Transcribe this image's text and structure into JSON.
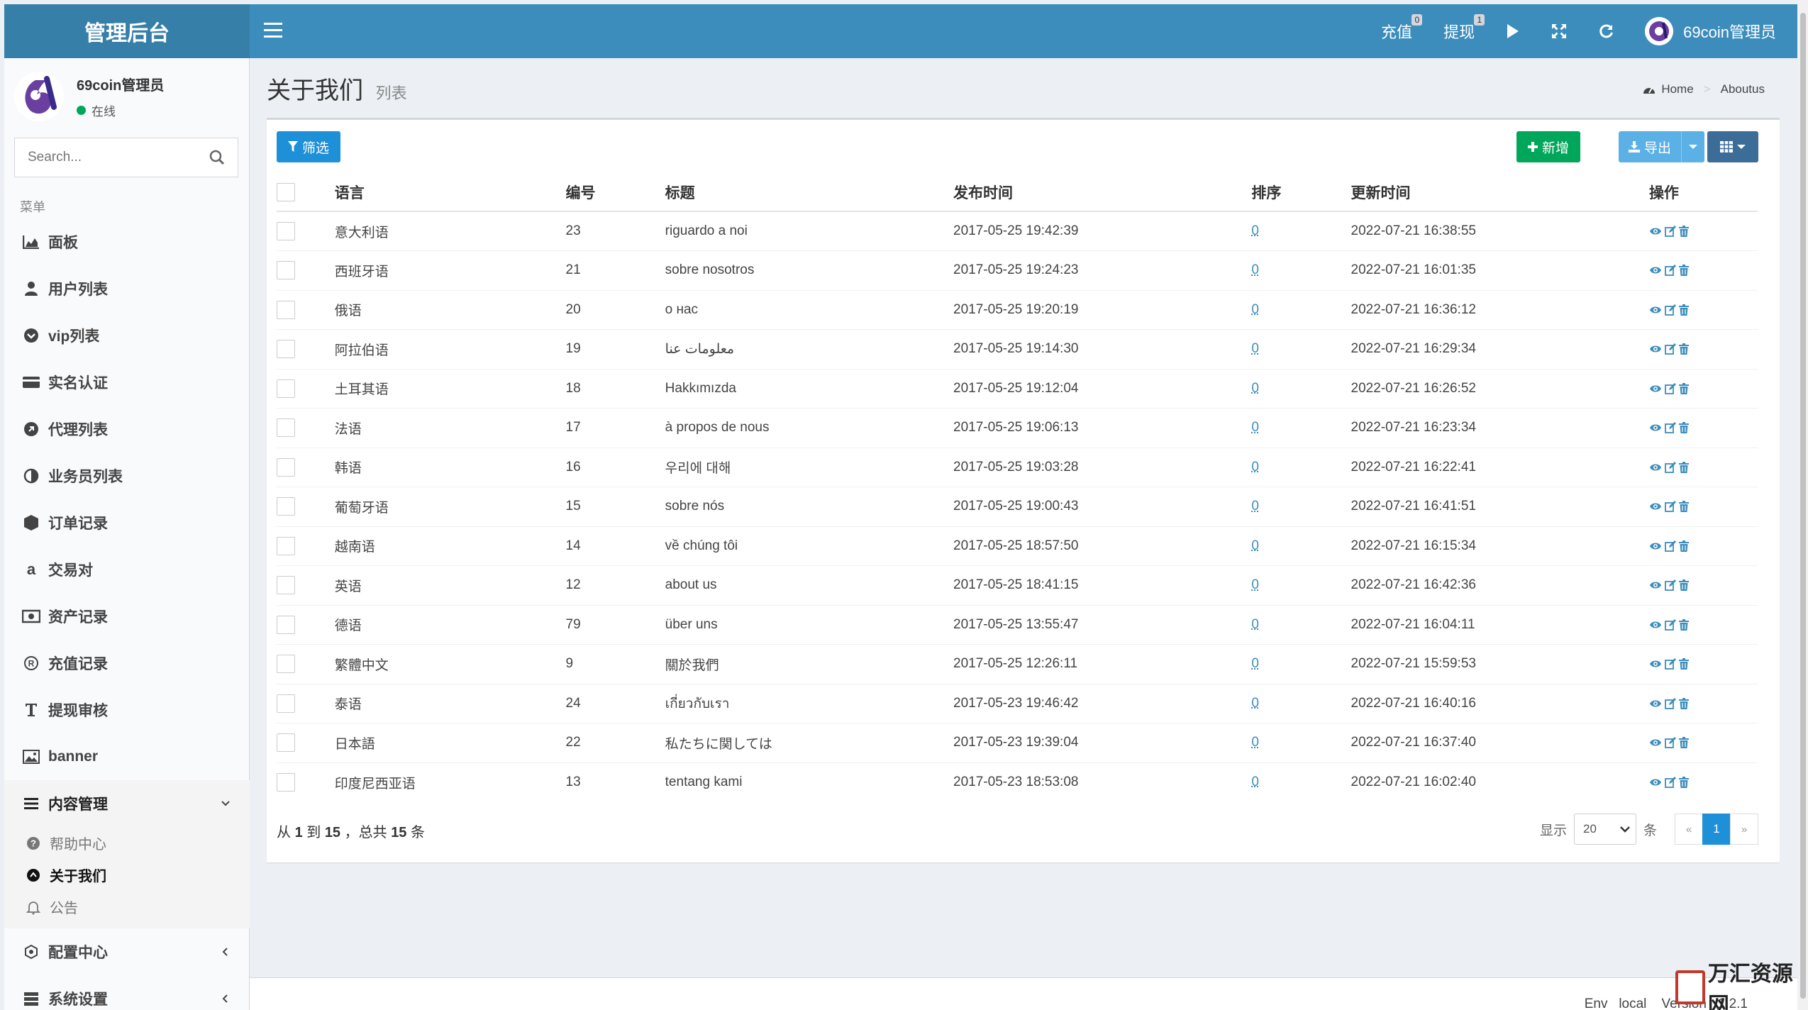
{
  "header": {
    "logo_text": "管理后台",
    "recharge_label": "充值",
    "recharge_badge": "0",
    "withdraw_label": "提现",
    "withdraw_badge": "1",
    "user_name": "69coin管理员"
  },
  "sidebar": {
    "user_name": "69coin管理员",
    "user_status": "在线",
    "search_placeholder": "Search...",
    "menu_header": "菜单",
    "items": [
      {
        "label": "面板",
        "icon": "area-chart-icon"
      },
      {
        "label": "用户列表",
        "icon": "users-icon"
      },
      {
        "label": "vip列表",
        "icon": "chevron-circle-icon"
      },
      {
        "label": "实名认证",
        "icon": "credit-card-icon"
      },
      {
        "label": "代理列表",
        "icon": "arrow-circle-icon"
      },
      {
        "label": "业务员列表",
        "icon": "adjust-icon"
      },
      {
        "label": "订单记录",
        "icon": "hexagon-icon"
      },
      {
        "label": "交易对",
        "icon": "amazon-icon"
      },
      {
        "label": "资产记录",
        "icon": "money-icon"
      },
      {
        "label": "充值记录",
        "icon": "registered-icon"
      },
      {
        "label": "提现审核",
        "icon": "text-height-icon"
      },
      {
        "label": "banner",
        "icon": "image-icon"
      }
    ],
    "content_menu": {
      "label": "内容管理",
      "sub_items": [
        {
          "label": "帮助中心",
          "icon": "question-circle-icon",
          "active": false
        },
        {
          "label": "关于我们",
          "icon": "upload-circle-icon",
          "active": true
        },
        {
          "label": "公告",
          "icon": "bell-icon",
          "active": false
        }
      ]
    },
    "config_label": "配置中心",
    "system_label": "系统设置"
  },
  "content": {
    "title": "关于我们",
    "subtitle": "列表",
    "breadcrumb_home": "Home",
    "breadcrumb_current": "Aboutus"
  },
  "toolbar": {
    "filter_label": "筛选",
    "add_label": "新增",
    "export_label": "导出"
  },
  "table": {
    "columns": [
      "语言",
      "编号",
      "标题",
      "发布时间",
      "排序",
      "更新时间",
      "操作"
    ],
    "rows": [
      {
        "lang": "意大利语",
        "id": "23",
        "title": "riguardo a noi",
        "published": "2017-05-25 19:42:39",
        "sort": "0",
        "updated": "2022-07-21 16:38:55"
      },
      {
        "lang": "西班牙语",
        "id": "21",
        "title": "sobre nosotros",
        "published": "2017-05-25 19:24:23",
        "sort": "0",
        "updated": "2022-07-21 16:01:35"
      },
      {
        "lang": "俄语",
        "id": "20",
        "title": "о нас",
        "published": "2017-05-25 19:20:19",
        "sort": "0",
        "updated": "2022-07-21 16:36:12"
      },
      {
        "lang": "阿拉伯语",
        "id": "19",
        "title": "معلومات عنا",
        "published": "2017-05-25 19:14:30",
        "sort": "0",
        "updated": "2022-07-21 16:29:34"
      },
      {
        "lang": "土耳其语",
        "id": "18",
        "title": "Hakkımızda",
        "published": "2017-05-25 19:12:04",
        "sort": "0",
        "updated": "2022-07-21 16:26:52"
      },
      {
        "lang": "法语",
        "id": "17",
        "title": "à propos de nous",
        "published": "2017-05-25 19:06:13",
        "sort": "0",
        "updated": "2022-07-21 16:23:34"
      },
      {
        "lang": "韩语",
        "id": "16",
        "title": "우리에 대해",
        "published": "2017-05-25 19:03:28",
        "sort": "0",
        "updated": "2022-07-21 16:22:41"
      },
      {
        "lang": "葡萄牙语",
        "id": "15",
        "title": "sobre nós",
        "published": "2017-05-25 19:00:43",
        "sort": "0",
        "updated": "2022-07-21 16:41:51"
      },
      {
        "lang": "越南语",
        "id": "14",
        "title": "về chúng tôi",
        "published": "2017-05-25 18:57:50",
        "sort": "0",
        "updated": "2022-07-21 16:15:34"
      },
      {
        "lang": "英语",
        "id": "12",
        "title": "about us",
        "published": "2017-05-25 18:41:15",
        "sort": "0",
        "updated": "2022-07-21 16:42:36"
      },
      {
        "lang": "德语",
        "id": "79",
        "title": "über uns",
        "published": "2017-05-25 13:55:47",
        "sort": "0",
        "updated": "2022-07-21 16:04:11"
      },
      {
        "lang": "繁體中文",
        "id": "9",
        "title": "關於我們",
        "published": "2017-05-25 12:26:11",
        "sort": "0",
        "updated": "2022-07-21 15:59:53"
      },
      {
        "lang": "泰语",
        "id": "24",
        "title": "เกี่ยวกับเรา",
        "published": "2017-05-23 19:46:42",
        "sort": "0",
        "updated": "2022-07-21 16:40:16"
      },
      {
        "lang": "日本語",
        "id": "22",
        "title": "私たちに関しては",
        "published": "2017-05-23 19:39:04",
        "sort": "0",
        "updated": "2022-07-21 16:37:40"
      },
      {
        "lang": "印度尼西亚语",
        "id": "13",
        "title": "tentang kami",
        "published": "2017-05-23 18:53:08",
        "sort": "0",
        "updated": "2022-07-21 16:02:40"
      }
    ]
  },
  "pagination": {
    "info_prefix": "从 ",
    "from": "1",
    "info_to": " 到 ",
    "to": "15",
    "info_total": " ，总共 ",
    "total": "15",
    "info_suffix": " 条",
    "show_label": "显示",
    "page_size": "20",
    "per_label": "条",
    "prev": "«",
    "current": "1",
    "next": "»"
  },
  "footer": {
    "env_text": "Env   local    Version   1.2.1"
  },
  "watermark": {
    "text": "万汇资源网"
  },
  "colors": {
    "primary": "#3c8dbc",
    "success": "#00a65a",
    "info": "#5bb0e6",
    "filter": "#1e90d8"
  }
}
